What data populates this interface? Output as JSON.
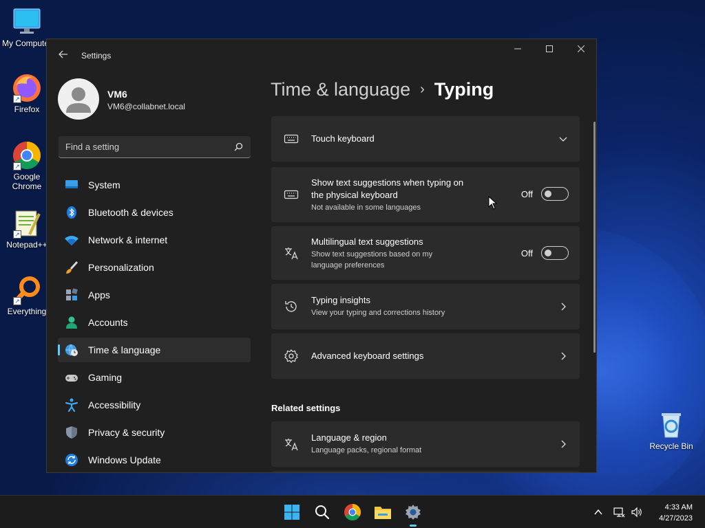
{
  "desktop": {
    "icons": [
      {
        "label": "My Computer"
      },
      {
        "label": "Firefox"
      },
      {
        "label": "Google Chrome"
      },
      {
        "label": "Notepad++"
      },
      {
        "label": "Everything"
      },
      {
        "label": "Recycle Bin"
      }
    ]
  },
  "window": {
    "title": "Settings",
    "controls": {
      "minimize": "—",
      "maximize": "☐",
      "close": "✕"
    }
  },
  "profile": {
    "name": "VM6",
    "email": "VM6@collabnet.local"
  },
  "search": {
    "placeholder": "Find a setting"
  },
  "nav": {
    "items": [
      {
        "label": "System",
        "icon": "monitor-icon"
      },
      {
        "label": "Bluetooth & devices",
        "icon": "bluetooth-icon"
      },
      {
        "label": "Network & internet",
        "icon": "wifi-icon"
      },
      {
        "label": "Personalization",
        "icon": "brush-icon"
      },
      {
        "label": "Apps",
        "icon": "apps-icon"
      },
      {
        "label": "Accounts",
        "icon": "person-icon"
      },
      {
        "label": "Time & language",
        "icon": "globe-clock-icon",
        "active": true
      },
      {
        "label": "Gaming",
        "icon": "gamepad-icon"
      },
      {
        "label": "Accessibility",
        "icon": "accessibility-icon"
      },
      {
        "label": "Privacy & security",
        "icon": "shield-icon"
      },
      {
        "label": "Windows Update",
        "icon": "update-icon"
      }
    ]
  },
  "main": {
    "breadcrumb": {
      "parent": "Time & language",
      "separator": "›",
      "current": "Typing"
    },
    "cards": [
      {
        "title": "Touch keyboard",
        "icon": "keyboard-icon",
        "control": "expand"
      },
      {
        "title": "Show text suggestions when typing on the physical keyboard",
        "subtitle": "Not available in some languages",
        "icon": "keyboard-icon",
        "control": "toggle",
        "state": "Off"
      },
      {
        "title": "Multilingual text suggestions",
        "subtitle": "Show text suggestions based on my language preferences",
        "icon": "language-icon",
        "control": "toggle",
        "state": "Off"
      },
      {
        "title": "Typing insights",
        "subtitle": "View your typing and corrections history",
        "icon": "history-icon",
        "control": "link"
      },
      {
        "title": "Advanced keyboard settings",
        "icon": "gear-icon",
        "control": "link"
      }
    ],
    "related": {
      "heading": "Related settings",
      "cards": [
        {
          "title": "Language & region",
          "subtitle": "Language packs, regional format",
          "icon": "language-icon",
          "control": "link"
        }
      ]
    }
  },
  "taskbar": {
    "apps": [
      "start-icon",
      "search-icon",
      "chrome-icon",
      "file-explorer-icon",
      "settings-icon"
    ],
    "clock": {
      "time": "4:33 AM",
      "date": "4/27/2023"
    }
  },
  "colors": {
    "accent": "#60cdff",
    "window_bg": "#202020",
    "card_bg": "#2b2b2b"
  }
}
